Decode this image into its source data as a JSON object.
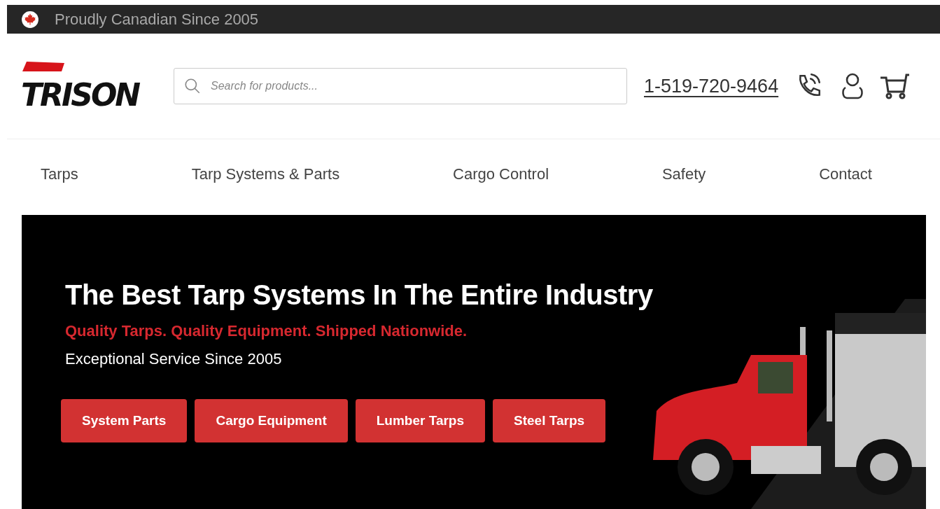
{
  "top_bar": {
    "text": "Proudly Canadian Since 2005"
  },
  "header": {
    "logo": "TRISON",
    "search": {
      "placeholder": "Search for products..."
    },
    "phone": "1-519-720-9464"
  },
  "nav": [
    {
      "label": "Tarps"
    },
    {
      "label": "Tarp Systems & Parts"
    },
    {
      "label": "Cargo Control"
    },
    {
      "label": "Safety"
    },
    {
      "label": "Contact"
    }
  ],
  "hero": {
    "title": "The Best Tarp Systems In The Entire Industry",
    "tagline": "Quality Tarps. Quality Equipment. Shipped Nationwide.",
    "subtitle": "Exceptional Service Since 2005",
    "buttons": [
      {
        "label": "System Parts"
      },
      {
        "label": "Cargo Equipment"
      },
      {
        "label": "Lumber Tarps"
      },
      {
        "label": "Steel Tarps"
      }
    ]
  }
}
